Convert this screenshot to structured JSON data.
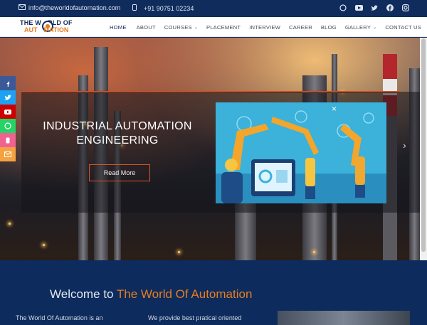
{
  "topbar": {
    "email": "info@theworldofautomation.com",
    "phone": "+91 90751 02234",
    "social_icons": [
      "whatsapp-icon",
      "youtube-icon",
      "twitter-icon",
      "facebook-icon",
      "instagram-icon"
    ]
  },
  "logo": {
    "line1": "THE W",
    "line1b": "RLD OF",
    "line2": "AUT",
    "line2b": "MATION"
  },
  "nav": {
    "items": [
      {
        "label": "HOME",
        "active": true
      },
      {
        "label": "ABOUT"
      },
      {
        "label": "COURSES",
        "dropdown": true
      },
      {
        "label": "PLACEMENT"
      },
      {
        "label": "INTERVIEW"
      },
      {
        "label": "CAREER"
      },
      {
        "label": "BLOG"
      },
      {
        "label": "GALLERY",
        "dropdown": true
      },
      {
        "label": "CONTACT US"
      }
    ]
  },
  "hero": {
    "title_line1": "INDUSTRIAL AUTOMATION",
    "title_line2": "ENGINEERING",
    "button": "Read More"
  },
  "share_bar": [
    {
      "icon": "facebook-icon",
      "color": "#3b5998"
    },
    {
      "icon": "twitter-icon",
      "color": "#1da1f2"
    },
    {
      "icon": "youtube-icon",
      "color": "#cc0000"
    },
    {
      "icon": "whatsapp-icon",
      "color": "#25d366"
    },
    {
      "icon": "sms-icon",
      "color": "#f06292"
    },
    {
      "icon": "email-icon",
      "color": "#f4a340"
    }
  ],
  "welcome": {
    "title_plain": "Welcome to ",
    "title_brand": "The World Of Automation",
    "col1": "The World Of Automation is an",
    "col2": "We provide best pratical oriented"
  },
  "colors": {
    "navy": "#0f2c5c",
    "orange": "#e67e22",
    "accent_line": "#d6552a"
  }
}
